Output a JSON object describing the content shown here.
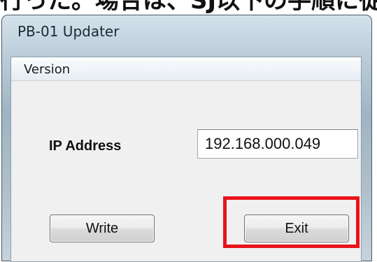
{
  "background_caption": "行った。場合は、SJ以下の手順に従って",
  "window": {
    "title": "PB-01 Updater"
  },
  "menu": {
    "items": [
      "Version"
    ]
  },
  "form": {
    "ip_label": "IP Address",
    "ip_value": "192.168.000.049"
  },
  "buttons": {
    "write": "Write",
    "exit": "Exit"
  },
  "highlight": {
    "target": "Exit",
    "color": "#e8141a"
  }
}
